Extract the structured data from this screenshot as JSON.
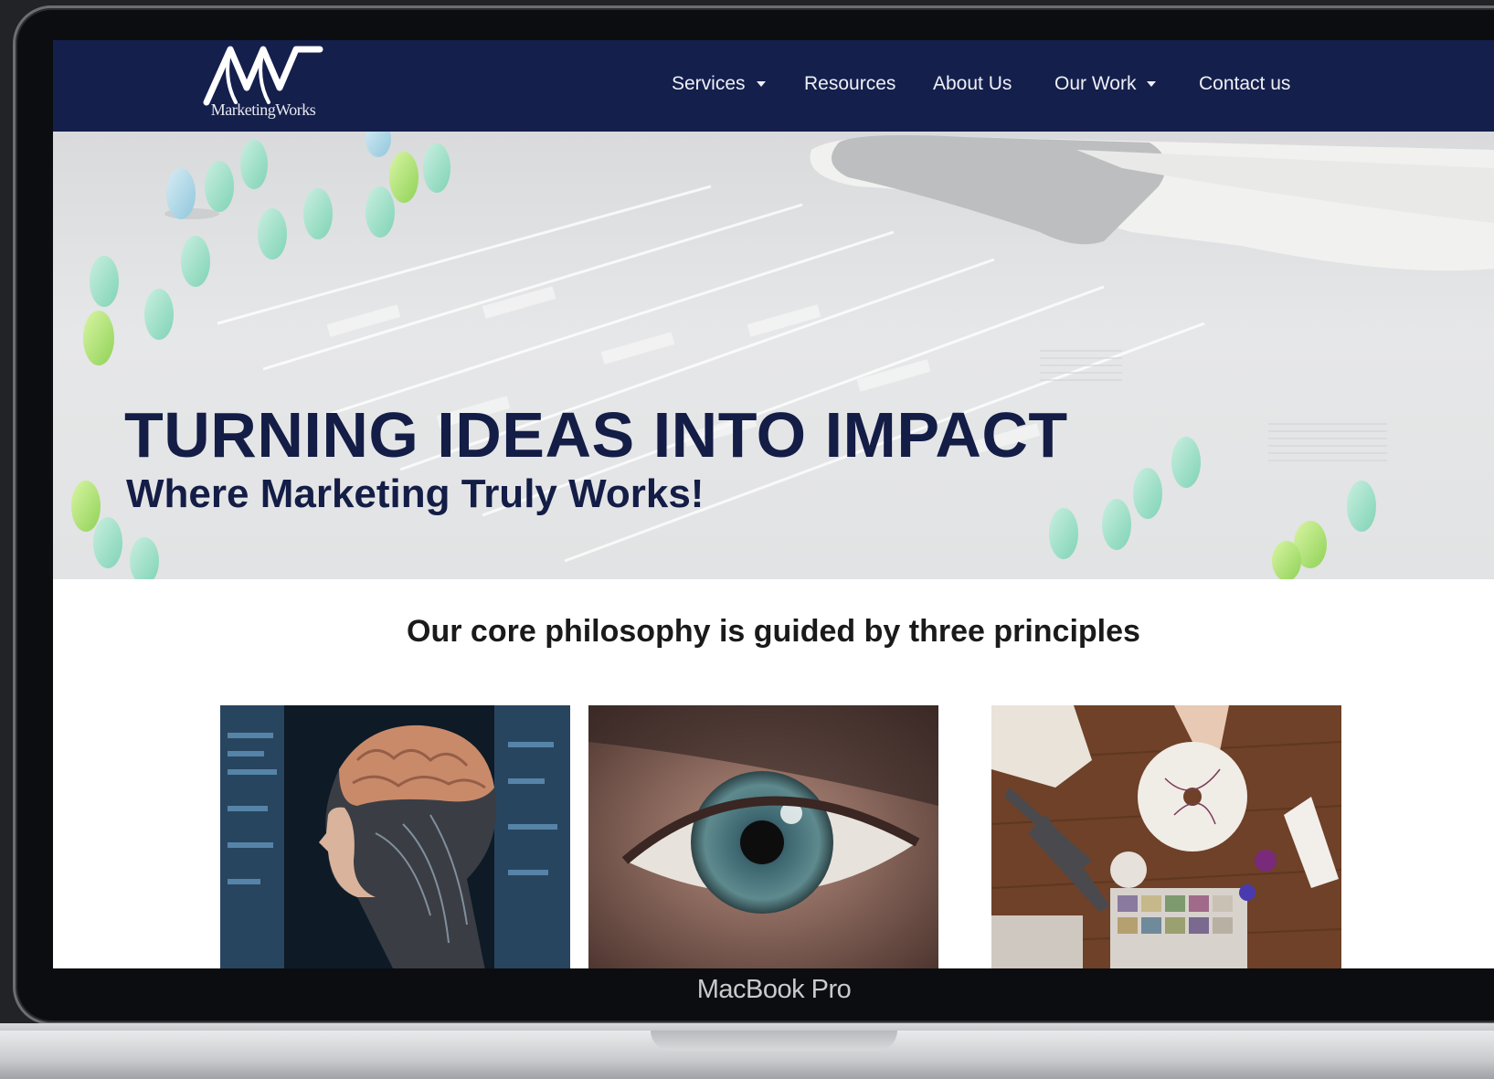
{
  "device": {
    "bezel_label": "MacBook Pro"
  },
  "brand": {
    "logo_text": "MarketingWorks",
    "navbar_color": "#141f4c"
  },
  "nav": {
    "items": [
      {
        "label": "Services",
        "dropdown": true
      },
      {
        "label": "Resources",
        "dropdown": false
      },
      {
        "label": "About Us",
        "dropdown": false
      },
      {
        "label": "Our Work",
        "dropdown": true
      },
      {
        "label": "Contact us",
        "dropdown": false
      }
    ]
  },
  "hero": {
    "title": "TURNING IDEAS INTO IMPACT",
    "subtitle": "Where Marketing Truly Works!",
    "text_color": "#131d46"
  },
  "philosophy": {
    "heading": "Our core philosophy is guided by three principles",
    "cards": [
      {
        "image": "ai-brain-head-image"
      },
      {
        "image": "eye-closeup-image"
      },
      {
        "image": "crafting-workbench-image"
      }
    ]
  }
}
